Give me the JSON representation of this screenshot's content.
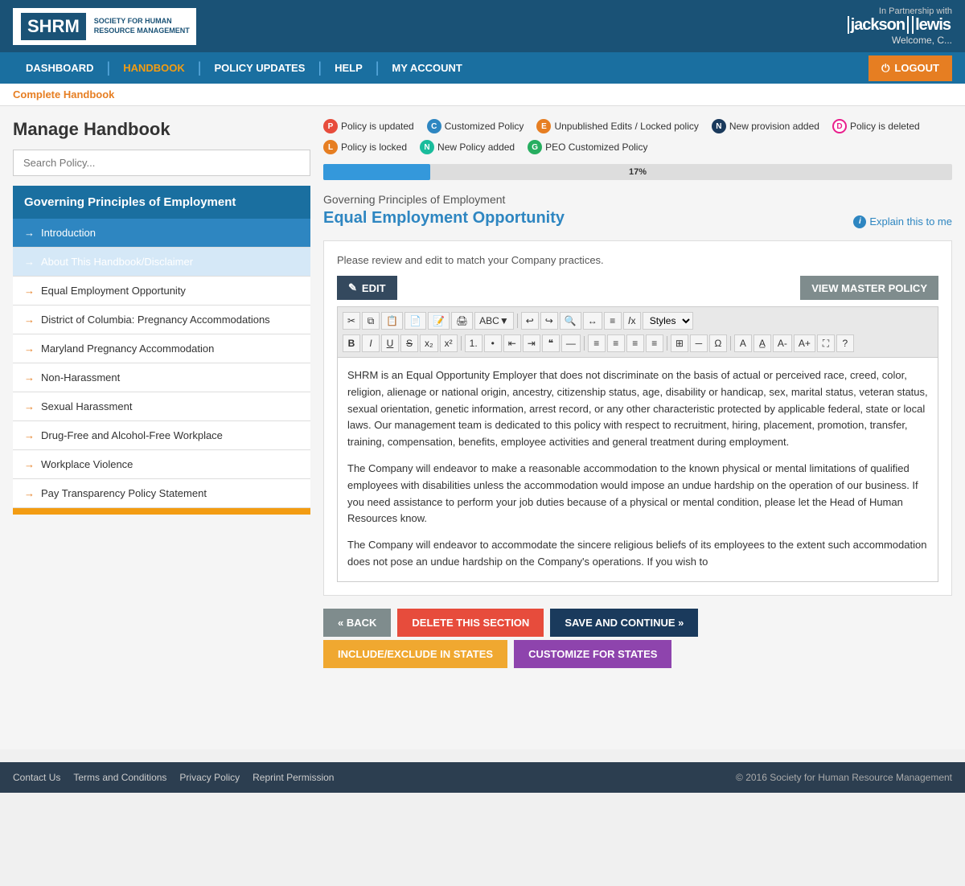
{
  "header": {
    "logo_text": "SHRM",
    "logo_subtitle": "SOCIETY FOR HUMAN\nRESOURCE MANAGEMENT",
    "partner_label": "In Partnership with",
    "partner_name_1": "jackson",
    "partner_name_2": "lewis",
    "welcome_text": "Welcome, C...",
    "logout_label": "LOGOUT"
  },
  "nav": {
    "items": [
      {
        "label": "DASHBOARD",
        "active": false
      },
      {
        "label": "HANDBOOK",
        "active": true
      },
      {
        "label": "POLICY UPDATES",
        "active": false
      },
      {
        "label": "HELP",
        "active": false
      },
      {
        "label": "MY ACCOUNT",
        "active": false
      }
    ]
  },
  "breadcrumb": {
    "label": "Complete Handbook"
  },
  "legend": {
    "items": [
      {
        "badge": "P",
        "color": "red",
        "label": "Policy is updated"
      },
      {
        "badge": "C",
        "color": "blue",
        "label": "Customized Policy"
      },
      {
        "badge": "E",
        "color": "orange",
        "label": "Unpublished Edits / Locked policy"
      },
      {
        "badge": "N",
        "color": "darkblue",
        "label": "New provision added"
      },
      {
        "badge": "D",
        "color": "pink",
        "label": "Policy is deleted"
      },
      {
        "badge": "L",
        "color": "orange",
        "label": "Policy is locked"
      },
      {
        "badge": "N",
        "color": "teal",
        "label": "New Policy added"
      },
      {
        "badge": "G",
        "color": "green",
        "label": "PEO Customized Policy"
      }
    ]
  },
  "progress": {
    "value": 17,
    "label": "17%"
  },
  "sidebar": {
    "title": "Manage Handbook",
    "search_placeholder": "Search Policy...",
    "group_header": "Governing Principles of Employment",
    "items": [
      {
        "label": "Introduction",
        "active": true
      },
      {
        "label": "About This Handbook/Disclaimer",
        "active": true
      },
      {
        "label": "Equal Employment Opportunity",
        "active": false
      },
      {
        "label": "District of Columbia: Pregnancy Accommodations",
        "active": false
      },
      {
        "label": "Maryland Pregnancy Accommodation",
        "active": false
      },
      {
        "label": "Non-Harassment",
        "active": false
      },
      {
        "label": "Sexual Harassment",
        "active": false
      },
      {
        "label": "Drug-Free and Alcohol-Free Workplace",
        "active": false
      },
      {
        "label": "Workplace Violence",
        "active": false
      },
      {
        "label": "Pay Transparency Policy Statement",
        "active": false
      }
    ]
  },
  "policy": {
    "breadcrumb": "Governing Principles of Employment",
    "title": "Equal Employment Opportunity",
    "explain_link": "Explain this to me",
    "review_text": "Please review and edit to match your Company practices.",
    "edit_label": "EDIT",
    "view_master_label": "VIEW MASTER POLICY",
    "content": [
      "SHRM is an Equal Opportunity Employer that does not discriminate on the basis of actual or perceived race, creed, color, religion, alienage or national origin, ancestry, citizenship status, age, disability or handicap, sex, marital status, veteran status, sexual orientation, genetic information, arrest record, or any other characteristic protected by applicable federal, state or local laws. Our management team is dedicated to this policy with respect to recruitment, hiring, placement, promotion, transfer, training, compensation, benefits, employee activities and general treatment during employment.",
      "The Company will endeavor to make a reasonable accommodation to the known physical or mental limitations of qualified employees with disabilities unless the accommodation would impose an undue hardship on the operation of our business. If you need assistance to perform your job duties because of a physical or mental condition, please let the Head of Human Resources know.",
      "The Company will endeavor to accommodate the sincere religious beliefs of its employees to the extent such accommodation does not pose an undue hardship on the Company's operations. If you wish to"
    ]
  },
  "buttons": {
    "back": "« BACK",
    "delete": "DELETE THIS SECTION",
    "save": "SAVE AND CONTINUE »",
    "include": "INCLUDE/EXCLUDE IN STATES",
    "customize": "CUSTOMIZE FOR STATES"
  },
  "footer": {
    "links": [
      "Contact Us",
      "Terms and Conditions",
      "Privacy Policy",
      "Reprint Permission"
    ],
    "copyright": "© 2016 Society for Human Resource Management"
  }
}
